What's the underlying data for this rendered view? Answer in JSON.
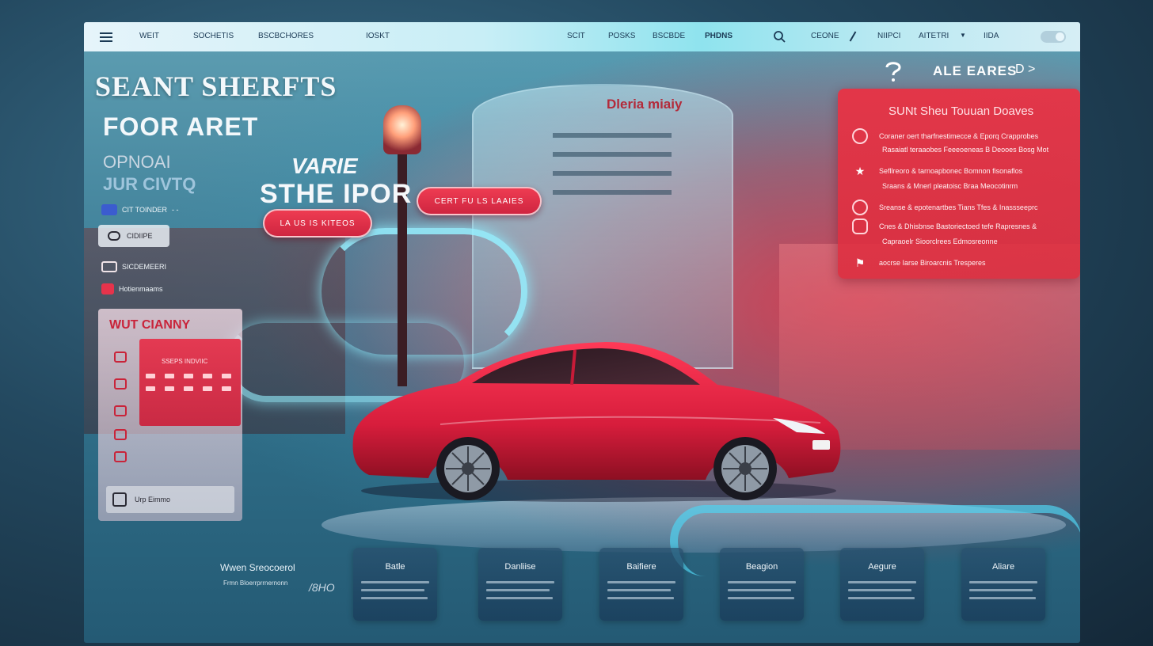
{
  "navbar": {
    "items_left": [
      "WEIT",
      "SOCHETIS",
      "BSCBCHORES",
      "IOSKT"
    ],
    "items_mid": [
      "SCIT",
      "POSKS",
      "BSCBDE",
      "PHDNS"
    ],
    "items_right": [
      "CEONE",
      "NIIPCI",
      "AITETRI",
      "IIDA"
    ]
  },
  "hero": {
    "title_line1": "SEANT SHERFTS",
    "title_line2": "FOOR ARET",
    "sub_line1": "OPNOAI",
    "sub_line2": "JUR CIVTQ",
    "row1_label": "CIT TOINDER",
    "pill_label": "CIDIIPE",
    "row2_label": "SICDEMEERI",
    "row3_label": "Hotienmaams"
  },
  "left_panel": {
    "title": "WUT CIANNY",
    "inner_label": "SSEPS INDVIIC",
    "footer_label": "Urp Eimmo"
  },
  "promo": {
    "line1": "VARIE",
    "line2": "STHE IPOR",
    "button1": "LA US IS KITEOS",
    "button2": "CERT FU LS LAAIES"
  },
  "tower_sign": "Dleria miaiy",
  "right_callout": {
    "title": "ALE EARES",
    "arrows": "D >"
  },
  "red_panel": {
    "title": "SUNt Sheu Touuan Doaves",
    "rows": [
      "Coraner oert tharfnestimecce & Eporq Crapprobes",
      "Rasaiatl teraaobes Feeeoeneas B Deooes Bosg Mot",
      "Sefllreoro & tarnoapbonec Bomnon fisonaflos",
      "Sraans & Mnerl pleatoisc Braa Meocotinrm",
      "Sreanse & epotenartbes Tians Tfes & Inassseeprc",
      "Cnes & Dhisbnse Bastoriectoed tefe Rapresnes &",
      "Capraoelr Sioorclrees Edmosreonne",
      "aocrse Iarse Biroarcnis Tresperes"
    ]
  },
  "bottom_caption": {
    "title": "Wwen Sreocoerol",
    "sub": "Frmn Bloerrprrnernonn",
    "code": "/8HO"
  },
  "cards": [
    {
      "title": "Batle"
    },
    {
      "title": "Danliise"
    },
    {
      "title": "Baifiere"
    },
    {
      "title": "Beagion"
    },
    {
      "title": "Aegure"
    },
    {
      "title": "Aliare"
    }
  ],
  "colors": {
    "accent_red": "#e6334b",
    "accent_cyan": "#8fe3ee",
    "navy": "#1b3a55"
  }
}
